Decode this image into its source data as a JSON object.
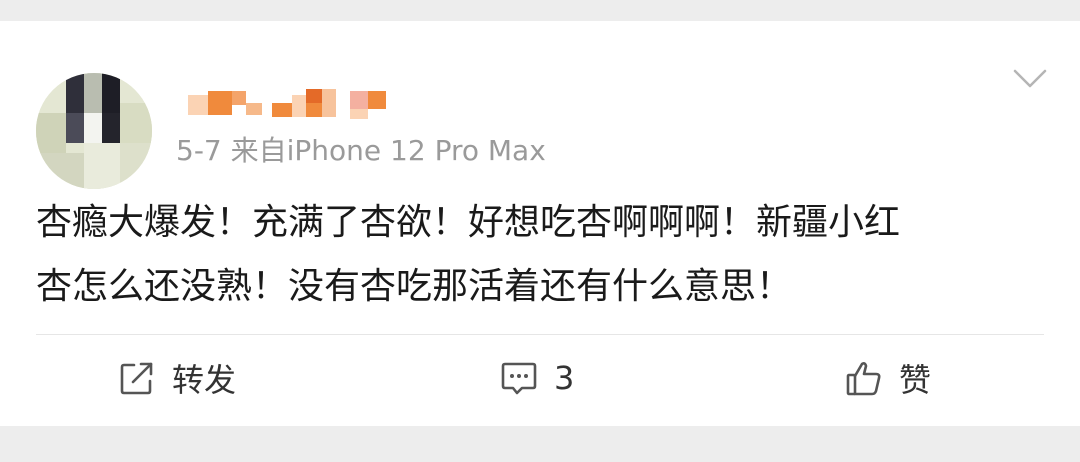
{
  "post": {
    "meta": "5-7  来自iPhone 12 Pro Max",
    "text": "杏瘾大爆发！充满了杏欲！好想吃杏啊啊啊！新疆小红\n杏怎么还没熟！没有杏吃那活着还有什么意思！"
  },
  "actions": {
    "repost_label": "转发",
    "comment_count": "3",
    "like_label": "赞"
  },
  "icons": {
    "more": "chevron-down-icon",
    "repost": "repost-icon",
    "comment": "comment-icon",
    "like": "thumbs-up-icon"
  },
  "colors": {
    "page_background": "#ededed",
    "card_background": "#ffffff",
    "text_primary": "#1a1a1a",
    "text_secondary": "#9a9a9a",
    "username_orange": "#f08a3c"
  }
}
